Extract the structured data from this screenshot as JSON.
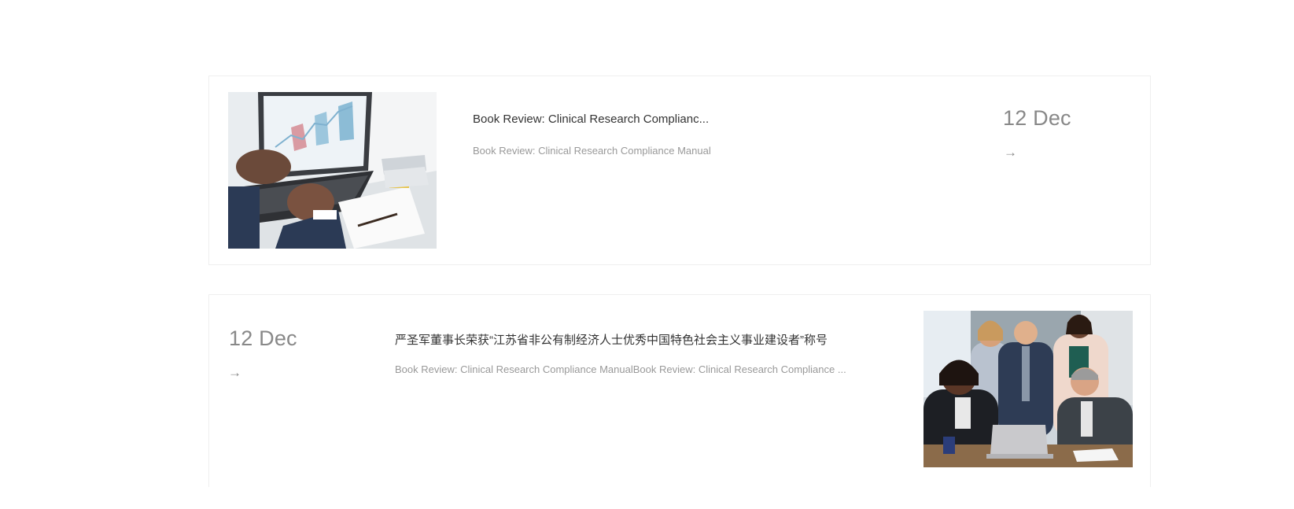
{
  "posts": [
    {
      "title": "Book Review: Clinical Research Complianc...",
      "excerpt": "Book Review: Clinical Research Compliance Manual",
      "date": "12 Dec",
      "arrow": "→",
      "image": "laptop-analytics-photo"
    },
    {
      "title": "严圣军董事长荣获“江苏省非公有制经济人士优秀中国特色社会主义事业建设者”称号",
      "excerpt": "Book Review: Clinical Research Compliance ManualBook Review: Clinical Research Compliance ...",
      "date": "12 Dec",
      "arrow": "→",
      "image": "business-team-meeting-photo"
    }
  ]
}
